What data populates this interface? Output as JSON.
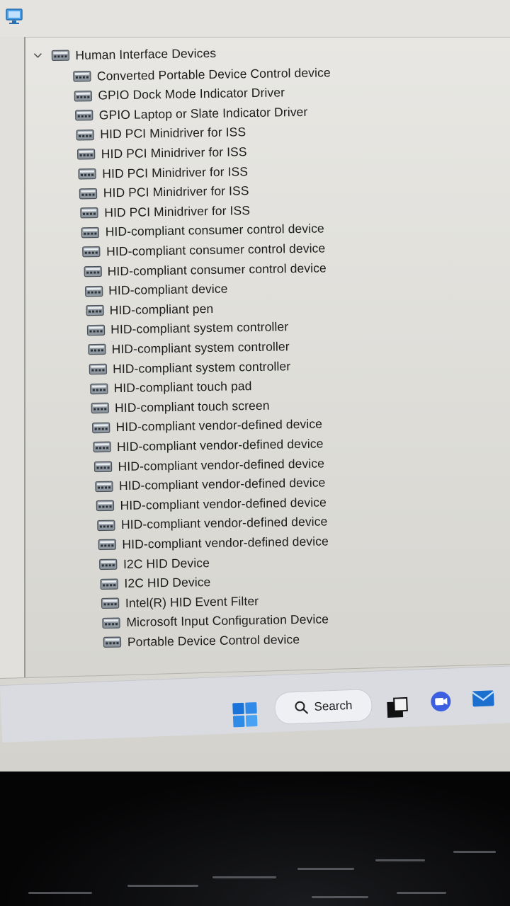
{
  "tree": {
    "category": {
      "label": "Human Interface Devices",
      "expanded": true,
      "icon": "hid-device-icon",
      "chevron": "chevron-down-icon"
    },
    "devices": [
      "Converted Portable Device Control device",
      "GPIO Dock Mode Indicator Driver",
      "GPIO Laptop or Slate Indicator Driver",
      "HID PCI Minidriver for ISS",
      "HID PCI Minidriver for ISS",
      "HID PCI Minidriver for ISS",
      "HID PCI Minidriver for ISS",
      "HID PCI Minidriver for ISS",
      "HID-compliant consumer control device",
      "HID-compliant consumer control device",
      "HID-compliant consumer control device",
      "HID-compliant device",
      "HID-compliant pen",
      "HID-compliant system controller",
      "HID-compliant system controller",
      "HID-compliant system controller",
      "HID-compliant touch pad",
      "HID-compliant touch screen",
      "HID-compliant vendor-defined device",
      "HID-compliant vendor-defined device",
      "HID-compliant vendor-defined device",
      "HID-compliant vendor-defined device",
      "HID-compliant vendor-defined device",
      "HID-compliant vendor-defined device",
      "HID-compliant vendor-defined device",
      "I2C HID Device",
      "I2C HID Device",
      "Intel(R) HID Event Filter",
      "Microsoft Input Configuration Device",
      "Portable Device Control device"
    ]
  },
  "taskbar": {
    "search_label": "Search",
    "start_icon": "windows-start-icon",
    "search_icon": "search-icon",
    "apps": [
      "task-view-icon",
      "meet-chat-icon",
      "mail-icon"
    ]
  },
  "colors": {
    "accent": "#1a73d9",
    "text": "#1c1c1c",
    "background": "#e9e8e4"
  }
}
